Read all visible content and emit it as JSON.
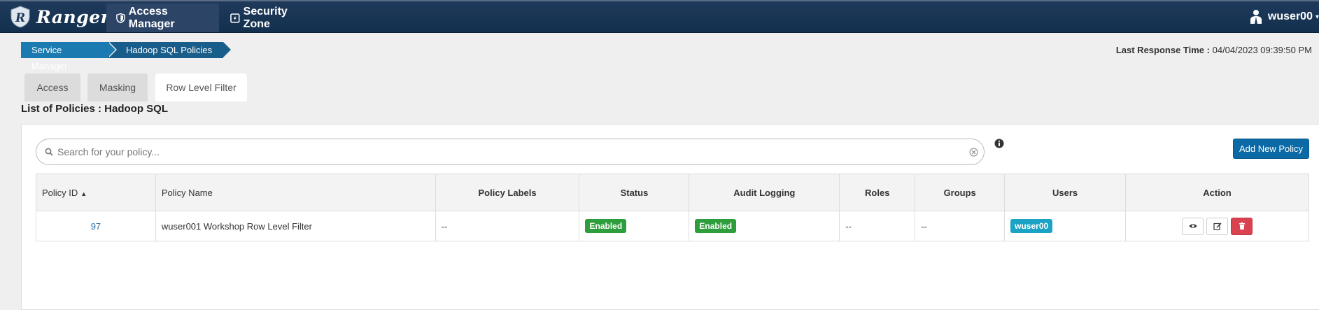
{
  "navbar": {
    "brand": "Ranger",
    "items": [
      {
        "label": "Access Manager",
        "icon": "shield-icon"
      },
      {
        "label": "Security Zone",
        "icon": "zone-icon"
      }
    ],
    "user": "wuser00"
  },
  "breadcrumb": [
    "Service Manager",
    "Hadoop SQL Policies"
  ],
  "last_response": {
    "label": "Last Response Time :",
    "value": "04/04/2023 09:39:50 PM"
  },
  "tabs": [
    {
      "label": "Access",
      "active": false
    },
    {
      "label": "Masking",
      "active": false
    },
    {
      "label": "Row Level Filter",
      "active": true
    }
  ],
  "list_title": "List of Policies : Hadoop SQL",
  "search": {
    "placeholder": "Search for your policy..."
  },
  "add_button": "Add New Policy",
  "table": {
    "headers": [
      "Policy ID",
      "Policy Name",
      "Policy Labels",
      "Status",
      "Audit Logging",
      "Roles",
      "Groups",
      "Users",
      "Action"
    ],
    "rows": [
      {
        "policy_id": "97",
        "policy_name": "wuser001 Workshop Row Level Filter",
        "labels": "--",
        "status": "Enabled",
        "audit": "Enabled",
        "roles": "--",
        "groups": "--",
        "users": "wuser00"
      }
    ]
  },
  "colors": {
    "navbar": "#1f3a5a",
    "crumb1": "#1b7ab0",
    "crumb2": "#195e8a",
    "primary": "#0b6aa6",
    "success": "#2e9e3c",
    "info": "#1aa3c4",
    "danger": "#d9424f"
  }
}
